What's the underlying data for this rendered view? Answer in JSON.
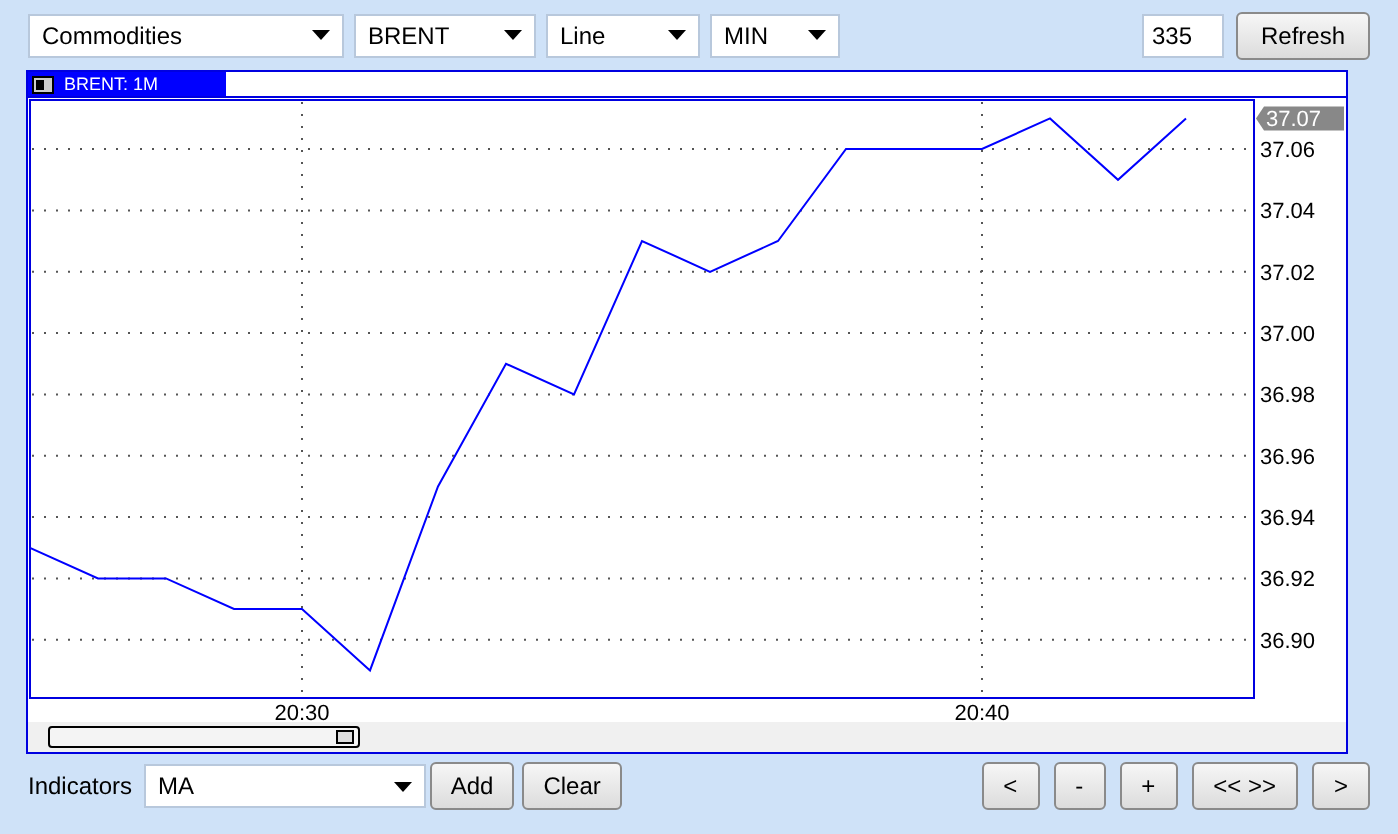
{
  "toolbar": {
    "market": "Commodities",
    "symbol": "BRENT",
    "chart_type": "Line",
    "interval": "MIN",
    "count": "335",
    "refresh": "Refresh"
  },
  "chart": {
    "label": "BRENT: 1M",
    "current_price": "37.07",
    "chart_data": {
      "type": "line",
      "categories": [
        null,
        null,
        null,
        null,
        "20:30",
        null,
        null,
        null,
        null,
        null,
        null,
        null,
        null,
        null,
        "20:40",
        null,
        null,
        null
      ],
      "series": [
        {
          "color": "#0000ff",
          "values": [
            36.93,
            36.92,
            36.92,
            36.91,
            36.91,
            36.89,
            36.95,
            36.99,
            36.98,
            37.03,
            37.02,
            37.03,
            37.06,
            37.06,
            37.06,
            37.07,
            37.05,
            37.07
          ]
        }
      ],
      "ylim": [
        36.881,
        37.076
      ],
      "grid": true,
      "yticks": [
        {
          "value": 36.9,
          "label": "36.90"
        },
        {
          "value": 36.92,
          "label": "36.92"
        },
        {
          "value": 36.94,
          "label": "36.94"
        },
        {
          "value": 36.96,
          "label": "36.96"
        },
        {
          "value": 36.98,
          "label": "36.98"
        },
        {
          "value": 37.0,
          "label": "37.00"
        },
        {
          "value": 37.02,
          "label": "37.02"
        },
        {
          "value": 37.04,
          "label": "37.04"
        },
        {
          "value": 37.06,
          "label": "37.06"
        }
      ]
    }
  },
  "bottom": {
    "indicators_label": "Indicators",
    "indicator": "MA",
    "add": "Add",
    "clear": "Clear",
    "nav_buttons": [
      "<",
      "-",
      "+",
      "<< >>",
      ">"
    ]
  }
}
